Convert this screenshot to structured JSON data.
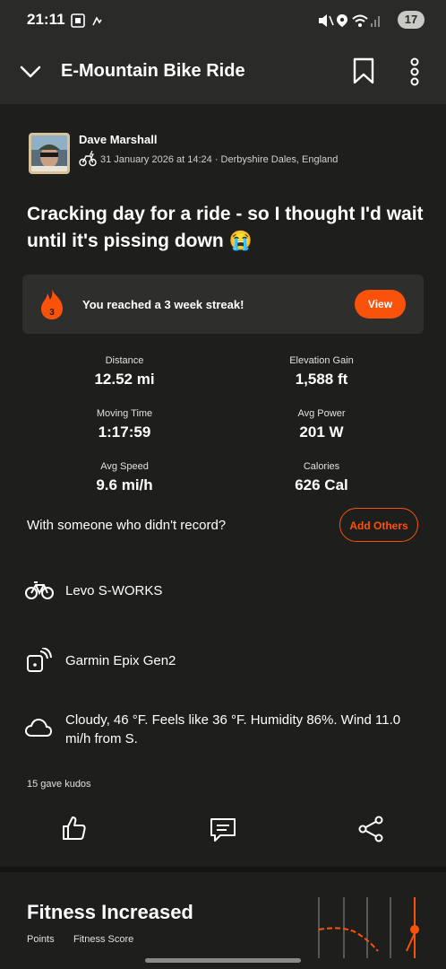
{
  "status_bar": {
    "time": "21:11",
    "battery": "17"
  },
  "header": {
    "title": "E-Mountain Bike Ride"
  },
  "post": {
    "author": "Dave Marshall",
    "meta": "31 January 2026 at 14:24 · Derbyshire Dales, England",
    "title": "Cracking day for a ride - so I thought I'd wait until it's pissing down 😭"
  },
  "streak": {
    "badge": "3",
    "text": "You reached a 3 week streak!",
    "button": "View"
  },
  "stats": [
    {
      "label": "Distance",
      "value": "12.52 mi"
    },
    {
      "label": "Elevation Gain",
      "value": "1,588 ft"
    },
    {
      "label": "Moving Time",
      "value": "1:17:59"
    },
    {
      "label": "Avg Power",
      "value": "201 W"
    },
    {
      "label": "Avg Speed",
      "value": "9.6 mi/h"
    },
    {
      "label": "Calories",
      "value": "626 Cal"
    }
  ],
  "others": {
    "question": "With someone who didn't record?",
    "button": "Add Others"
  },
  "gear": {
    "bike": "Levo S-WORKS",
    "device": "Garmin Epix Gen2"
  },
  "weather": {
    "text": "Cloudy, 46 °F. Feels like 36 °F. Humidity 86%. Wind 11.0 mi/h from S."
  },
  "kudos": {
    "text": "15 gave kudos"
  },
  "fitness": {
    "title": "Fitness Increased",
    "points_label": "Points",
    "score_label": "Fitness Score"
  },
  "colors": {
    "accent": "#f9530b",
    "background": "#1e1e1c",
    "card": "#2e2e2c"
  },
  "icons": [
    "chevron-down-icon",
    "bookmark-icon",
    "more-vertical-icon",
    "ebike-icon",
    "flame-icon",
    "bike-icon",
    "device-icon",
    "cloud-icon",
    "thumbs-up-icon",
    "comment-icon",
    "share-icon"
  ]
}
